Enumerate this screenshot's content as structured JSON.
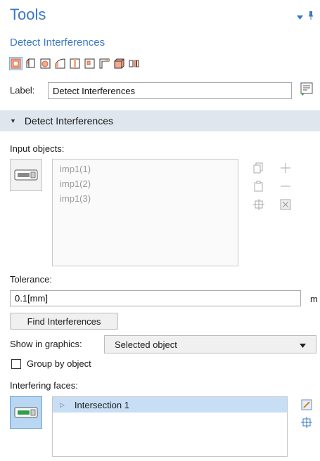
{
  "panel": {
    "title": "Tools",
    "subtitle": "Detect Interferences"
  },
  "label_field": {
    "label": "Label:",
    "value": "Detect Interferences"
  },
  "section": {
    "title": "Detect Interferences"
  },
  "input_objects": {
    "label": "Input objects:",
    "items": [
      "imp1(1)",
      "imp1(2)",
      "imp1(3)"
    ]
  },
  "tolerance": {
    "label": "Tolerance:",
    "value": "0.1[mm]",
    "unit": "m"
  },
  "find_button": "Find Interferences",
  "show_in_graphics": {
    "label": "Show in graphics:",
    "selected": "Selected object"
  },
  "group_by_object": {
    "label": "Group by object",
    "checked": false
  },
  "interfering_faces": {
    "label": "Interfering faces:",
    "items": [
      "Intersection 1"
    ]
  },
  "colors": {
    "accent": "#3a78c4",
    "section_bg": "#dfe6ee",
    "selected_row": "#c7def5"
  }
}
